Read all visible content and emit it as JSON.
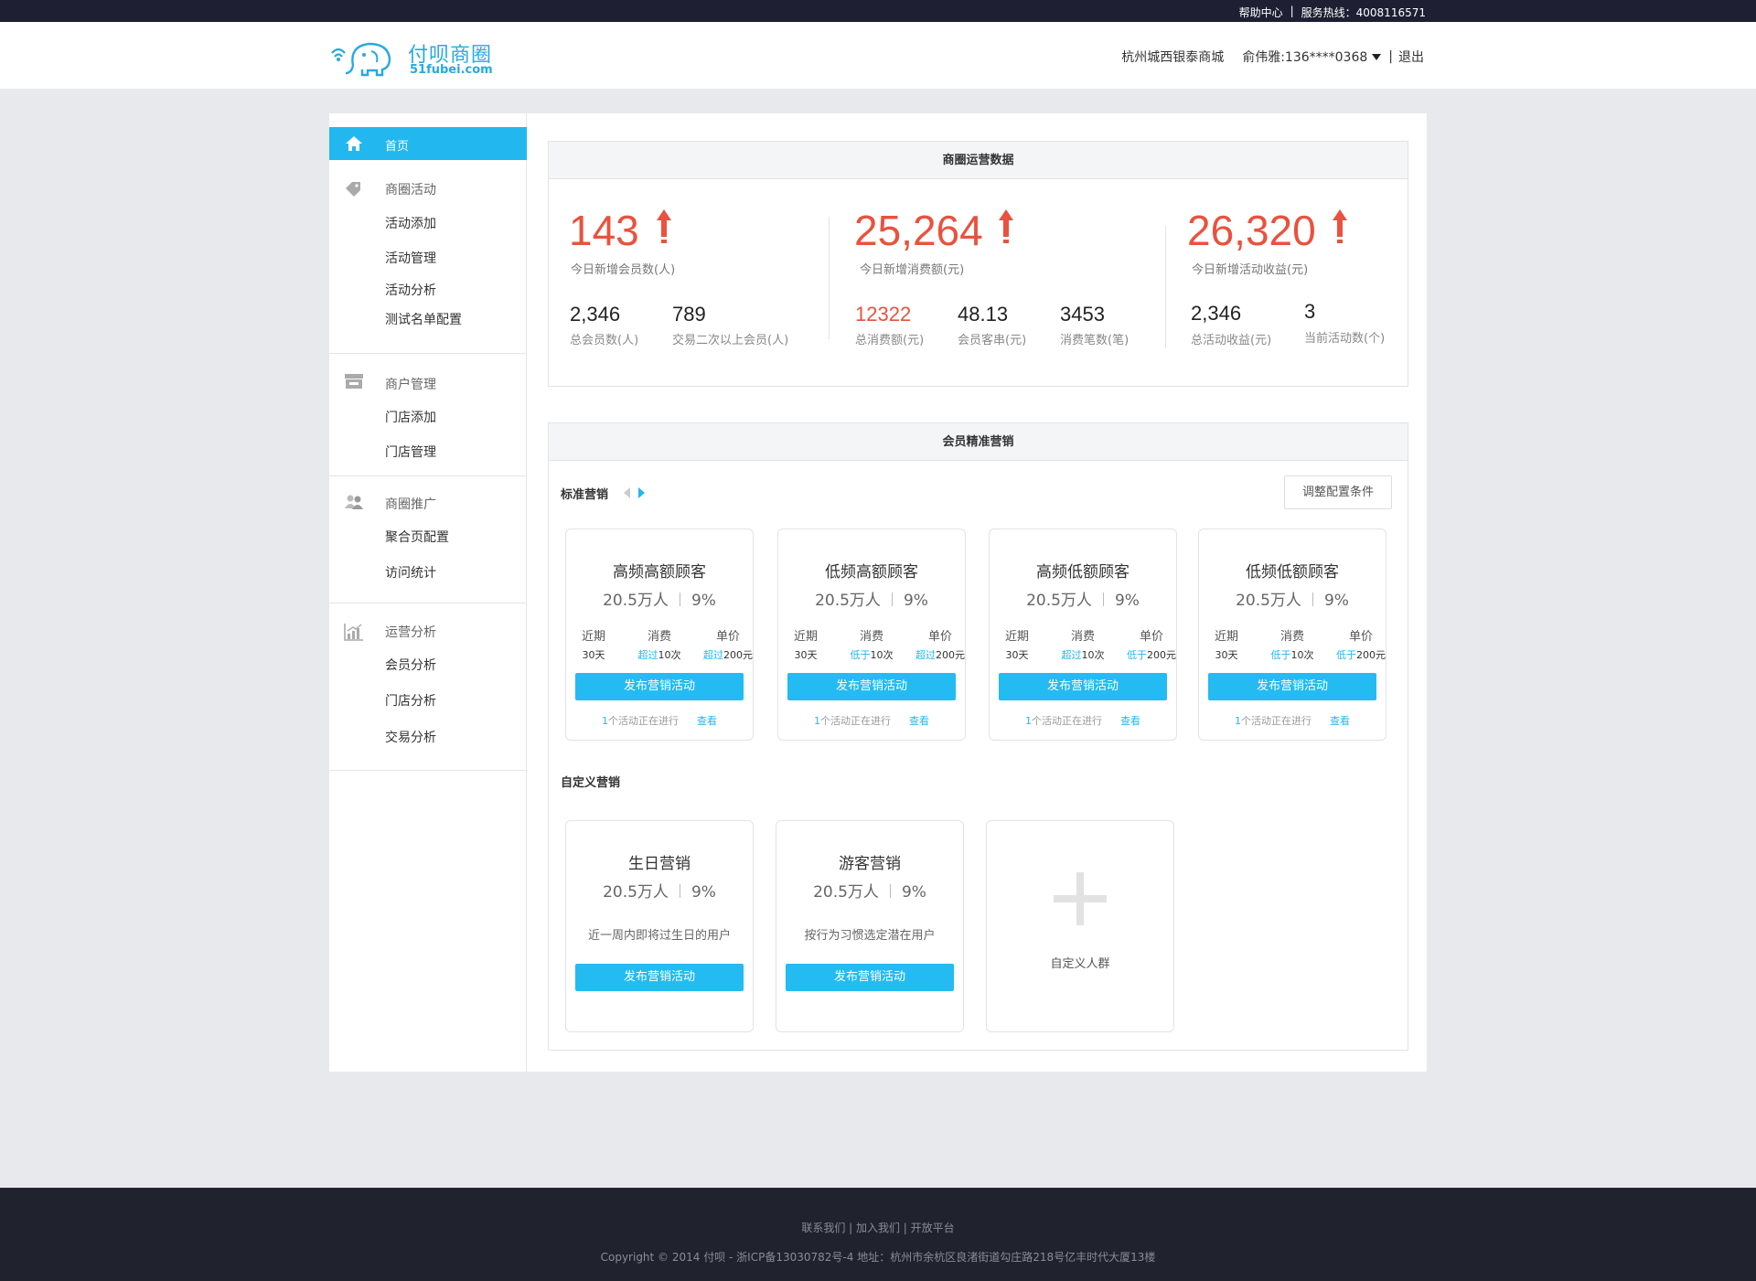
{
  "topbar": {
    "help": "帮助中心",
    "separator": "|",
    "hotline": "服务热线：4008116571"
  },
  "header": {
    "logo_cn": "付呗商圈",
    "logo_en": "51fubei.com",
    "mall": "杭州城西银泰商城",
    "user": "俞伟雅:136****0368",
    "separator": "|",
    "logout": "退出"
  },
  "sidebar": {
    "home": "首页",
    "groups": [
      {
        "title": "商圈活动",
        "icon": "tag-icon",
        "items": [
          "活动添加",
          "活动管理",
          "活动分析",
          "测试名单配置"
        ]
      },
      {
        "title": "商户管理",
        "icon": "store-icon",
        "items": [
          "门店添加",
          "门店管理"
        ]
      },
      {
        "title": "商圈推广",
        "icon": "users-icon",
        "items": [
          "聚合页配置",
          "访问统计"
        ]
      },
      {
        "title": "运营分析",
        "icon": "chart-icon",
        "items": [
          "会员分析",
          "门店分析",
          "交易分析"
        ]
      }
    ]
  },
  "ops": {
    "title": "商圈运营数据",
    "kpis": [
      {
        "value": "143",
        "label": "今日新增会员数(人)"
      },
      {
        "value": "25,264",
        "label": "今日新增消费额(元)"
      },
      {
        "value": "26,320",
        "label": "今日新增活动收益(元)"
      }
    ],
    "stats": [
      {
        "value": "2,346",
        "label": "总会员数(人)"
      },
      {
        "value": "789",
        "label": "交易二次以上会员(人)"
      },
      {
        "value": "12322",
        "label": "总消费额(元)"
      },
      {
        "value": "48.13",
        "label": "会员客串(元)"
      },
      {
        "value": "3453",
        "label": "消费笔数(笔)"
      },
      {
        "value": "2,346",
        "label": "总活动收益(元)"
      },
      {
        "value": "3",
        "label": "当前活动数(个)"
      }
    ]
  },
  "marketing": {
    "title": "会员精准营销",
    "standard_label": "标准营销",
    "adjust_button": "调整配置条件",
    "metric_titles": [
      "近期",
      "消费",
      "单价"
    ],
    "cards": [
      {
        "title": "高频高额顾客",
        "count": "20.5万人",
        "pct": "9%",
        "period": "30天",
        "freq_hl": "超过",
        "freq": "10次",
        "price_hl": "超过",
        "price": "200元",
        "button": "发布营销活动",
        "foot_num": "1",
        "foot": "个活动正在进行",
        "link": "查看"
      },
      {
        "title": "低频高额顾客",
        "count": "20.5万人",
        "pct": "9%",
        "period": "30天",
        "freq_hl": "低于",
        "freq": "10次",
        "price_hl": "超过",
        "price": "200元",
        "button": "发布营销活动",
        "foot_num": "1",
        "foot": "个活动正在进行",
        "link": "查看"
      },
      {
        "title": "高频低额顾客",
        "count": "20.5万人",
        "pct": "9%",
        "period": "30天",
        "freq_hl": "超过",
        "freq": "10次",
        "price_hl": "低于",
        "price": "200元",
        "button": "发布营销活动",
        "foot_num": "1",
        "foot": "个活动正在进行",
        "link": "查看"
      },
      {
        "title": "低频低额顾客",
        "count": "20.5万人",
        "pct": "9%",
        "period": "30天",
        "freq_hl": "低于",
        "freq": "10次",
        "price_hl": "低于",
        "price": "200元",
        "button": "发布营销活动",
        "foot_num": "1",
        "foot": "个活动正在进行",
        "link": "查看"
      }
    ],
    "custom_label": "自定义营销",
    "custom_cards": [
      {
        "title": "生日营销",
        "count": "20.5万人",
        "pct": "9%",
        "desc": "近一周内即将过生日的用户",
        "button": "发布营销活动"
      },
      {
        "title": "游客营销",
        "count": "20.5万人",
        "pct": "9%",
        "desc": "按行为习惯选定潜在用户",
        "button": "发布营销活动"
      }
    ],
    "add_custom": "自定义人群"
  },
  "footer": {
    "links": "联系我们 | 加入我们 | 开放平台",
    "copyright": "Copyright © 2014 付呗 - 浙ICP备13030782号-4 地址：杭州市余杭区良渚街道勾庄路218号亿丰时代大厦13楼"
  },
  "colors": {
    "accent": "#23b7f0",
    "up_red": "#e9523e",
    "topbar": "#1f1f33",
    "footer": "#20222e"
  }
}
